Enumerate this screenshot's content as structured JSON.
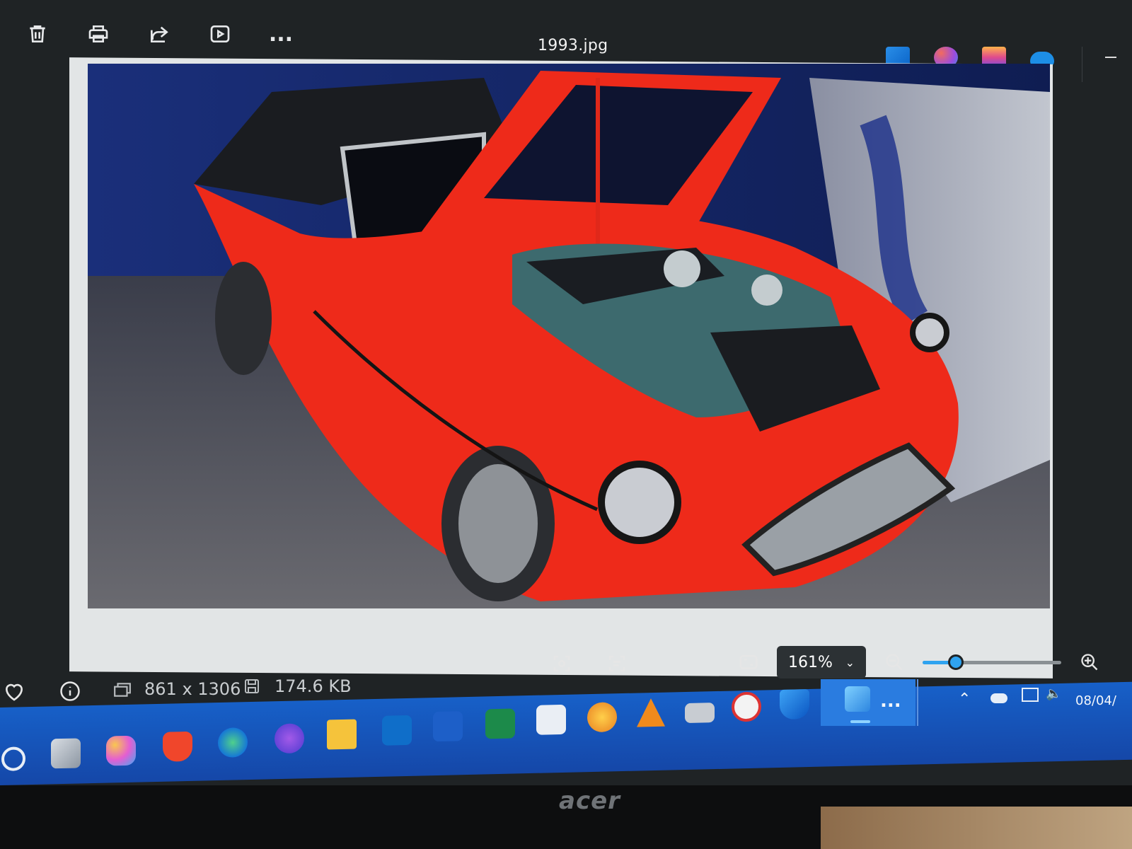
{
  "viewer": {
    "file_name": "1993.jpg",
    "toolbar": {
      "delete_icon": "trash-icon",
      "print_icon": "printer-icon",
      "share_icon": "share-icon",
      "slideshow_icon": "play-icon",
      "more_label": "..."
    },
    "zoom": {
      "level_label": "161%",
      "slider_fraction": 0.24
    },
    "image_info": {
      "dimensions": "861 x 1306",
      "file_size": "174.6 KB"
    }
  },
  "taskbar": {
    "more_label": "...",
    "date_fragment": "08/04/"
  },
  "monitor": {
    "brand": "acer"
  },
  "colors": {
    "accent": "#2fa3f0",
    "taskbar": "#1653b6",
    "car_red": "#ee2a1a"
  }
}
